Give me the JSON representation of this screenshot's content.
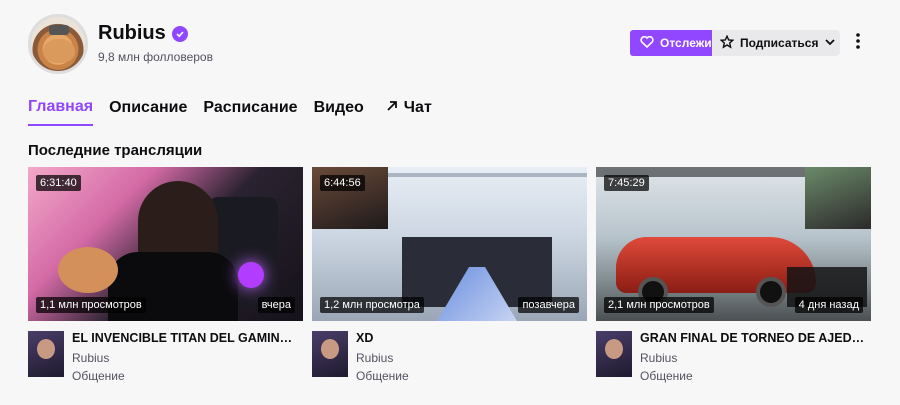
{
  "channel": {
    "name": "Rubius",
    "followers": "9,8 млн фолловеров"
  },
  "actions": {
    "follow_label": "Отслеживать",
    "subscribe_label": "Подписаться"
  },
  "tabs": [
    {
      "label": "Главная",
      "active": true
    },
    {
      "label": "Описание",
      "active": false
    },
    {
      "label": "Расписание",
      "active": false
    },
    {
      "label": "Видео",
      "active": false
    },
    {
      "label": "Чат",
      "active": false
    }
  ],
  "section": {
    "title": "Последние трансляции"
  },
  "videos": [
    {
      "duration": "6:31:40",
      "views": "1,1 млн просмотров",
      "date": "вчера",
      "title": "EL INVENCIBLE TITAN DEL GAMING VUELVE",
      "channel": "Rubius",
      "category": "Общение"
    },
    {
      "duration": "6:44:56",
      "views": "1,2 млн просмотра",
      "date": "позавчера",
      "title": "XD",
      "channel": "Rubius",
      "category": "Общение"
    },
    {
      "duration": "7:45:29",
      "views": "2,1 млн просмотров",
      "date": "4 дня назад",
      "title": "GRAN FINAL DE TORNEO DE AJEDREZ DE STREAMERS",
      "channel": "Rubius",
      "category": "Общение"
    }
  ],
  "colors": {
    "accent": "#9146ff",
    "background": "#f7f7f8"
  },
  "icons": {
    "verified": "verified-check-icon",
    "follow": "heart-icon",
    "subscribe": "star-icon",
    "dropdown": "chevron-down-icon",
    "more": "vertical-dots-icon",
    "chat": "arrow-up-right-icon"
  }
}
